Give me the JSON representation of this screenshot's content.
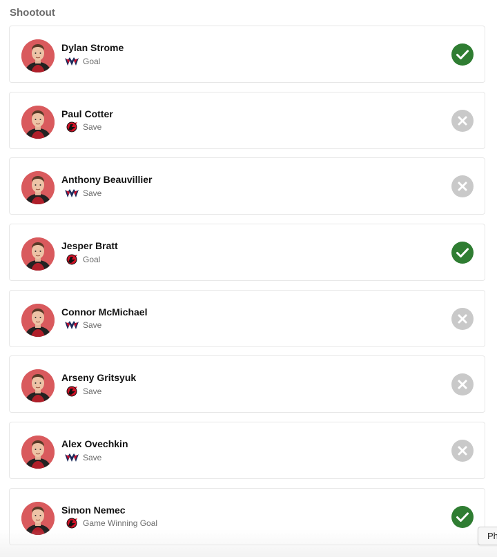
{
  "section_title": "Shootout",
  "colors": {
    "goal": "#2f7d32",
    "miss": "#c9c9c9",
    "caps_blue": "#1b2b5c",
    "caps_red": "#c8102e",
    "devils_red": "#ce1126"
  },
  "attempts": [
    {
      "player": "Dylan Strome",
      "team": "capitals",
      "result_label": "Goal",
      "scored": true
    },
    {
      "player": "Paul Cotter",
      "team": "devils",
      "result_label": "Save",
      "scored": false
    },
    {
      "player": "Anthony Beauvillier",
      "team": "capitals",
      "result_label": "Save",
      "scored": false
    },
    {
      "player": "Jesper Bratt",
      "team": "devils",
      "result_label": "Goal",
      "scored": true
    },
    {
      "player": "Connor McMichael",
      "team": "capitals",
      "result_label": "Save",
      "scored": false
    },
    {
      "player": "Arseny Gritsyuk",
      "team": "devils",
      "result_label": "Save",
      "scored": false
    },
    {
      "player": "Alex Ovechkin",
      "team": "capitals",
      "result_label": "Save",
      "scored": false
    },
    {
      "player": "Simon Nemec",
      "team": "devils",
      "result_label": "Game Winning Goal",
      "scored": true
    }
  ],
  "partial_button_label": "Ph"
}
